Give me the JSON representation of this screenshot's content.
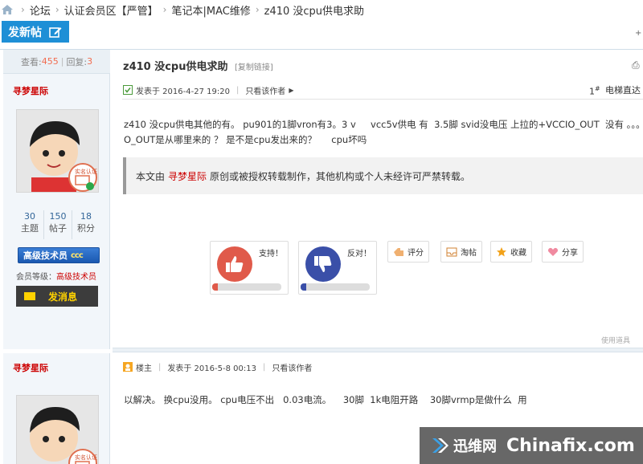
{
  "breadcrumb": {
    "items": [
      "论坛",
      "认证会员区【严管】",
      "笔记本|MAC维修",
      "z410 没cpu供电求助"
    ]
  },
  "toolbar": {
    "new_post_label": "发新帖",
    "right_fragment": "+"
  },
  "thread": {
    "views_label": "查看:",
    "views": "455",
    "replies_label": "回复:",
    "replies": "3",
    "title": "z410 没cpu供电求助",
    "copy_link": "[复制链接]"
  },
  "posts": [
    {
      "author": "寻梦星际",
      "badge_text": "实名认证",
      "stats": [
        {
          "value": "30",
          "label": "主题"
        },
        {
          "value": "150",
          "label": "帖子"
        },
        {
          "value": "18",
          "label": "积分"
        }
      ],
      "rank": "高级技术员",
      "rank_suffix": "ccc",
      "level_label": "会员等级：",
      "level_value": "高级技术员",
      "message_button": "发消息",
      "posted_label": "发表于 2016-4-27 19:20",
      "only_author": "只看该作者",
      "floor": "1",
      "floor_suffix": "#",
      "direct_jump": "电梯直达",
      "content": "z410 没cpu供电其他的有。 pu901的1脚vron有3。3 v     vcc5v供电 有  3.5脚 svid没电压 上拉的+VCCIO_OUT  没有 。。。 +VCCI\nO_OUT是从哪里来的 ？ 是不是cpu发出来的？     cpu坏吗",
      "copyright_prefix": "本文由",
      "copyright_author": "寻梦星际",
      "copyright_suffix": "原创或被授权转载制作，其他机构或个人未经许可严禁转载。",
      "support_label": "支持！",
      "oppose_label": "反对！",
      "support_ratio": 0.08,
      "oppose_ratio": 0.08,
      "actions": [
        "评分",
        "淘帖",
        "收藏",
        "分享"
      ],
      "tools_label": "使用道具"
    },
    {
      "author": "寻梦星际",
      "badge_text": "实名认证",
      "role": "楼主",
      "posted_label": "发表于 2016-5-8 00:13",
      "only_author": "只看该作者",
      "content": "以解决。 换cpu没用。 cpu电压不出   0.03电流。    30脚  1k电阻开路    30脚vrmp是做什么  用"
    }
  ],
  "watermark": {
    "cn": "迅维网",
    "en": "Chinafix.com"
  },
  "colors": {
    "accent": "#1e8fd6",
    "author_red": "#cc0000",
    "support": "#e05a4a",
    "oppose": "#3a4fa8"
  }
}
